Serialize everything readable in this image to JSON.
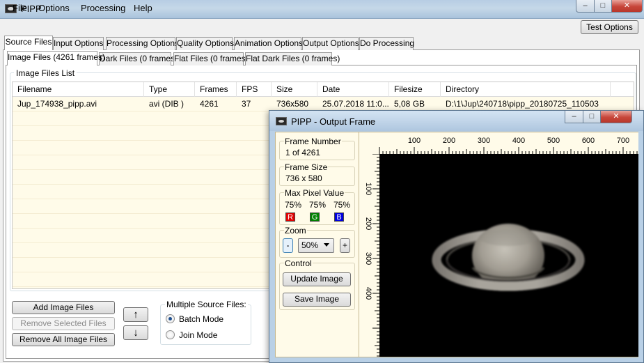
{
  "window": {
    "title": "PIPP",
    "controls": {
      "minimize": "–",
      "maximize": "□",
      "close": "✕"
    }
  },
  "menu": {
    "items": [
      "File",
      "Options",
      "Processing",
      "Help"
    ],
    "test_options": "Test Options"
  },
  "tabs": [
    "Source Files",
    "Input Options",
    "Processing Options",
    "Quality Options",
    "Animation Options",
    "Output Options",
    "Do Processing"
  ],
  "subtabs": [
    "Image Files (4261 frames)",
    "Dark Files (0 frames)",
    "Flat Files (0 frames)",
    "Flat Dark Files (0 frames)"
  ],
  "image_files_list": {
    "label": "Image Files List",
    "columns": [
      "Filename",
      "Type",
      "Frames",
      "FPS",
      "Size",
      "Date",
      "Filesize",
      "Directory"
    ],
    "rows": [
      [
        "Jup_174938_pipp.avi",
        "avi (DIB )",
        "4261",
        "37",
        "736x580",
        "25.07.2018 11:0...",
        "5,08 GB",
        "D:\\1\\Jup\\240718\\pipp_20180725_110503"
      ]
    ]
  },
  "buttons": {
    "add": "Add Image Files",
    "remove_selected": "Remove Selected Files",
    "remove_all": "Remove All Image Files",
    "up": "↑",
    "down": "↓"
  },
  "multi_source": {
    "label": "Multiple Source Files:",
    "batch": "Batch Mode",
    "join": "Join Mode",
    "selected": "batch"
  },
  "output_frame": {
    "title": "PIPP - Output Frame",
    "frame_number": {
      "label": "Frame Number",
      "value": "1 of 4261"
    },
    "frame_size": {
      "label": "Frame Size",
      "value": "736 x 580"
    },
    "max_pixel": {
      "label": "Max Pixel Value",
      "values": [
        "75%",
        "75%",
        "75%"
      ],
      "channels": [
        "R",
        "G",
        "B"
      ],
      "colors": [
        "#e00000",
        "#008000",
        "#0000e0"
      ]
    },
    "zoom": {
      "label": "Zoom",
      "value": "50%",
      "minus": "-",
      "plus": "+"
    },
    "control": {
      "label": "Control",
      "update": "Update Image",
      "save": "Save Image"
    },
    "ruler_top_labels": [
      "100",
      "200",
      "300",
      "400",
      "500",
      "600",
      "700"
    ],
    "ruler_left_labels": [
      "100",
      "200",
      "300",
      "400"
    ]
  }
}
